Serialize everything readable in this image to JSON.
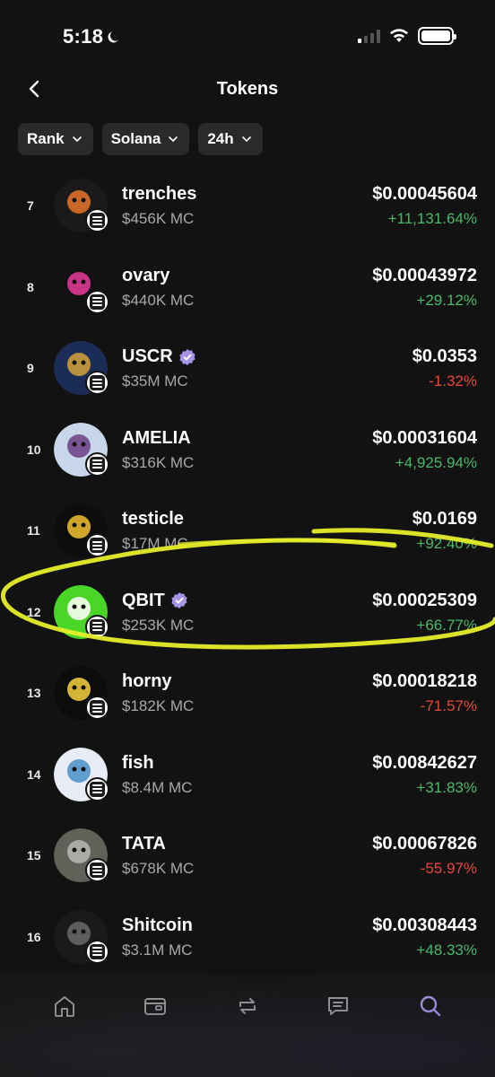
{
  "status_bar": {
    "time": "5:18",
    "moon_icon": "moon-icon",
    "signal_icon": "cellular-signal-icon",
    "wifi_icon": "wifi-icon",
    "battery_icon": "battery-icon"
  },
  "header": {
    "title": "Tokens",
    "back_icon": "chevron-left-icon"
  },
  "filters": [
    {
      "label": "Rank"
    },
    {
      "label": "Solana"
    },
    {
      "label": "24h"
    }
  ],
  "tokens": [
    {
      "rank": "7",
      "name": "trenches",
      "mc": "$456K MC",
      "price": "$0.00045604",
      "change": "+11,131.64%",
      "direction": "up",
      "verified": false,
      "avatar_color": "#1a1a1a",
      "avatar_accent": "#e8762c"
    },
    {
      "rank": "8",
      "name": "ovary",
      "mc": "$440K MC",
      "price": "$0.00043972",
      "change": "+29.12%",
      "direction": "up",
      "verified": false,
      "avatar_color": "#111111",
      "avatar_accent": "#e83b9b"
    },
    {
      "rank": "9",
      "name": "USCR",
      "mc": "$35M MC",
      "price": "$0.0353",
      "change": "-1.32%",
      "direction": "down",
      "verified": true,
      "avatar_color": "#1b2d57",
      "avatar_accent": "#d4a23a"
    },
    {
      "rank": "10",
      "name": "AMELIA",
      "mc": "$316K MC",
      "price": "$0.00031604",
      "change": "+4,925.94%",
      "direction": "up",
      "verified": false,
      "avatar_color": "#c8d6ea",
      "avatar_accent": "#6b3f84"
    },
    {
      "rank": "11",
      "name": "testicle",
      "mc": "$17M MC",
      "price": "$0.0169",
      "change": "+92.40%",
      "direction": "up",
      "verified": false,
      "avatar_color": "#0d0d0d",
      "avatar_accent": "#f2c230"
    },
    {
      "rank": "12",
      "name": "QBIT",
      "mc": "$253K MC",
      "price": "$0.00025309",
      "change": "+66.77%",
      "direction": "up",
      "verified": true,
      "avatar_color": "#49d627",
      "avatar_accent": "#ffffff"
    },
    {
      "rank": "13",
      "name": "horny",
      "mc": "$182K MC",
      "price": "$0.00018218",
      "change": "-71.57%",
      "direction": "down",
      "verified": false,
      "avatar_color": "#0c0c0c",
      "avatar_accent": "#f3d23c"
    },
    {
      "rank": "14",
      "name": "fish",
      "mc": "$8.4M MC",
      "price": "$0.00842627",
      "change": "+31.83%",
      "direction": "up",
      "verified": false,
      "avatar_color": "#e8ecf6",
      "avatar_accent": "#4a8fc8"
    },
    {
      "rank": "15",
      "name": "TATA",
      "mc": "$678K MC",
      "price": "$0.00067826",
      "change": "-55.97%",
      "direction": "down",
      "verified": false,
      "avatar_color": "#5f6258",
      "avatar_accent": "#b9b9b4"
    },
    {
      "rank": "16",
      "name": "Shitcoin",
      "mc": "$3.1M MC",
      "price": "$0.00308443",
      "change": "+48.33%",
      "direction": "up",
      "verified": false,
      "avatar_color": "#1a1a1a",
      "avatar_accent": "#6a6a6a"
    }
  ],
  "nav": [
    {
      "icon": "home-icon",
      "active": false
    },
    {
      "icon": "wallet-icon",
      "active": false
    },
    {
      "icon": "swap-icon",
      "active": false
    },
    {
      "icon": "chat-icon",
      "active": false
    },
    {
      "icon": "search-icon",
      "active": true
    }
  ],
  "colors": {
    "background": "#121212",
    "chip": "#2a2a2a",
    "positive": "#4ab96a",
    "negative": "#e5473d",
    "active_nav": "#a796e8",
    "inactive_nav": "#9a9a9a",
    "highlight": "#e6ef2a"
  }
}
